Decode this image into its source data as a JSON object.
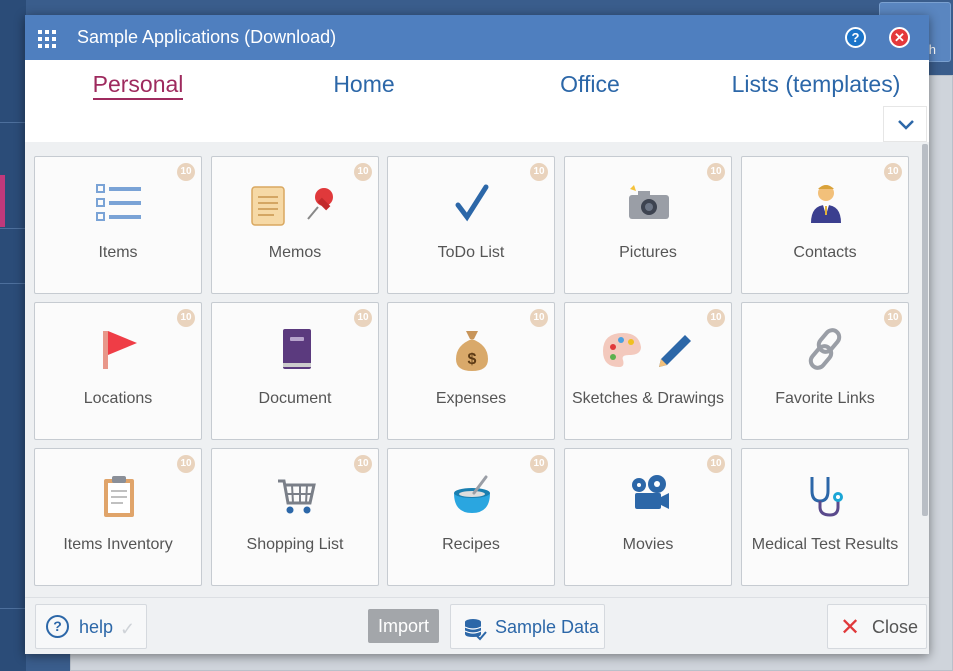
{
  "window": {
    "title": "Sample Applications (Download)"
  },
  "tabs": [
    {
      "label": "Personal",
      "active": true
    },
    {
      "label": "Home",
      "active": false
    },
    {
      "label": "Office",
      "active": false
    },
    {
      "label": "Lists (templates)",
      "active": false
    }
  ],
  "background": {
    "button_label": "h"
  },
  "tiles": [
    {
      "label": "Items",
      "badge": "10",
      "icon": "list-icon"
    },
    {
      "label": "Memos",
      "badge": "10",
      "icon": "scroll-pin-icon"
    },
    {
      "label": "ToDo List",
      "badge": "10",
      "icon": "checkmark-icon"
    },
    {
      "label": "Pictures",
      "badge": "10",
      "icon": "camera-icon"
    },
    {
      "label": "Contacts",
      "badge": "10",
      "icon": "person-icon"
    },
    {
      "label": "Locations",
      "badge": "10",
      "icon": "flag-icon"
    },
    {
      "label": "Document",
      "badge": "10",
      "icon": "book-icon"
    },
    {
      "label": "Expenses",
      "badge": "10",
      "icon": "money-bag-icon"
    },
    {
      "label": "Sketches & Drawings",
      "badge": "10",
      "icon": "palette-pen-icon"
    },
    {
      "label": "Favorite Links",
      "badge": "10",
      "icon": "chain-link-icon"
    },
    {
      "label": "Items Inventory",
      "badge": "10",
      "icon": "clipboard-icon"
    },
    {
      "label": "Shopping List",
      "badge": "10",
      "icon": "shopping-cart-icon"
    },
    {
      "label": "Recipes",
      "badge": "10",
      "icon": "bowl-icon"
    },
    {
      "label": "Movies",
      "badge": "10",
      "icon": "film-projector-icon"
    },
    {
      "label": "Medical Test Results",
      "badge": "",
      "icon": "stethoscope-icon"
    }
  ],
  "footer": {
    "help_label": "help",
    "import_label": "Import",
    "sample_data_label": "Sample Data",
    "close_label": "Close"
  },
  "colors": {
    "title_bar": "#4f7fbf",
    "active_tab": "#9e2a5e",
    "tab_text": "#2c67a8",
    "badge": "#e9d3bd",
    "close_red": "#e0393b"
  }
}
